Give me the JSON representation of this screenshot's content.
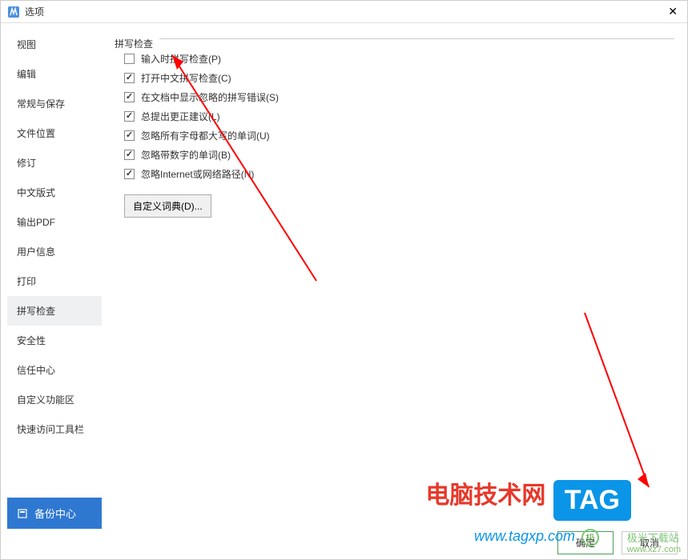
{
  "titlebar": {
    "title": "选项"
  },
  "sidebar": {
    "items": [
      {
        "label": "视图"
      },
      {
        "label": "编辑"
      },
      {
        "label": "常规与保存"
      },
      {
        "label": "文件位置"
      },
      {
        "label": "修订"
      },
      {
        "label": "中文版式"
      },
      {
        "label": "输出PDF"
      },
      {
        "label": "用户信息"
      },
      {
        "label": "打印"
      },
      {
        "label": "拼写检查"
      },
      {
        "label": "安全性"
      },
      {
        "label": "信任中心"
      },
      {
        "label": "自定义功能区"
      },
      {
        "label": "快速访问工具栏"
      }
    ],
    "backup_label": "备份中心"
  },
  "content": {
    "section_title": "拼写检查",
    "checkboxes": [
      {
        "label": "输入时拼写检查(P)",
        "checked": false
      },
      {
        "label": "打开中文拼写检查(C)",
        "checked": true
      },
      {
        "label": "在文档中显示忽略的拼写错误(S)",
        "checked": true
      },
      {
        "label": "总提出更正建议(L)",
        "checked": true
      },
      {
        "label": "忽略所有字母都大写的单词(U)",
        "checked": true
      },
      {
        "label": "忽略带数字的单词(B)",
        "checked": true
      },
      {
        "label": "忽略Internet或网络路径(N)",
        "checked": true
      }
    ],
    "custom_dict_btn": "自定义词典(D)..."
  },
  "footer": {
    "ok": "确定",
    "cancel": "取消"
  },
  "watermark": {
    "red_text": "电脑技术网",
    "tag": "TAG",
    "url": "www.tagxp.com",
    "site_cn": "极光下载站",
    "site_url": "www.xz7.com"
  }
}
